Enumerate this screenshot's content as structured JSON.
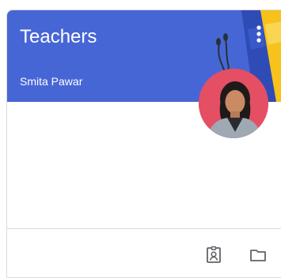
{
  "class_card": {
    "title": "Teachers",
    "teacher": "Smita Pawar",
    "banner_color": "#4766d6",
    "avatar_bg": "#e54f63",
    "icons": {
      "menu": "more-vert-icon",
      "assignments": "assignment-ind-icon",
      "folder": "folder-icon"
    }
  }
}
